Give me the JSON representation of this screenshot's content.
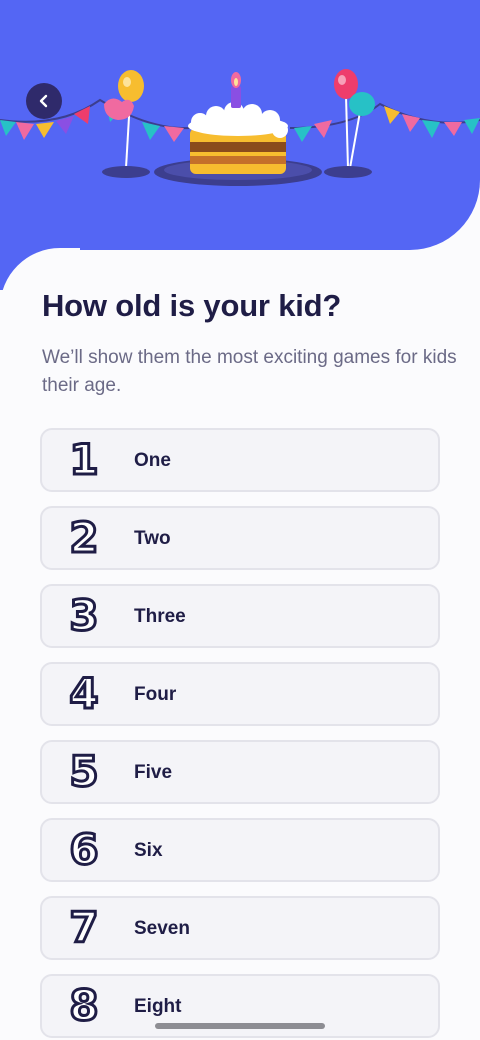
{
  "header": {
    "background": "#5466f4"
  },
  "page": {
    "title": "How old is your kid?",
    "subtitle": "We’ll show them the most exciting games for kids their age."
  },
  "options": [
    {
      "number": "1",
      "label": "One"
    },
    {
      "number": "2",
      "label": "Two"
    },
    {
      "number": "3",
      "label": "Three"
    },
    {
      "number": "4",
      "label": "Four"
    },
    {
      "number": "5",
      "label": "Five"
    },
    {
      "number": "6",
      "label": "Six"
    },
    {
      "number": "7",
      "label": "Seven"
    },
    {
      "number": "8",
      "label": "Eight"
    }
  ],
  "colors": {
    "accent": "#5466f4",
    "title": "#1f1d46",
    "subtitle": "#6b6a86",
    "option_bg": "#f4f4f8",
    "option_border": "#e3e3ea"
  },
  "icons": {
    "back": "chevron-left-icon",
    "banner": "birthday-cake-illustration"
  }
}
